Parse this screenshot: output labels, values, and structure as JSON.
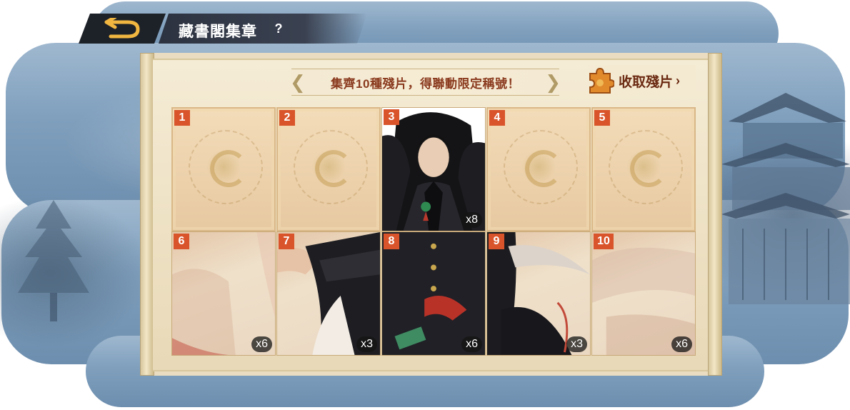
{
  "header": {
    "title": "藏書閣集章",
    "help_symbol": "?"
  },
  "banner": {
    "text": "集齊10種殘片，得聯動限定稱號！"
  },
  "collect_button": {
    "label": "收取殘片",
    "chevron": "›"
  },
  "pieces": [
    {
      "number": "1",
      "state": "locked",
      "count": ""
    },
    {
      "number": "2",
      "state": "locked",
      "count": ""
    },
    {
      "number": "3",
      "state": "owned",
      "count": "x8"
    },
    {
      "number": "4",
      "state": "locked",
      "count": ""
    },
    {
      "number": "5",
      "state": "locked",
      "count": ""
    },
    {
      "number": "6",
      "state": "owned",
      "count": "x6"
    },
    {
      "number": "7",
      "state": "owned",
      "count": "x3"
    },
    {
      "number": "8",
      "state": "owned",
      "count": "x6"
    },
    {
      "number": "9",
      "state": "owned",
      "count": "x3"
    },
    {
      "number": "10",
      "state": "owned",
      "count": "x6"
    }
  ],
  "icons": {
    "back": "back-arrow-icon",
    "help": "question-icon",
    "puzzle": "puzzle-piece-icon"
  },
  "colors": {
    "badge": "#d9542a",
    "banner_text": "#8a3a1e",
    "title_bar": "#1d2128"
  }
}
